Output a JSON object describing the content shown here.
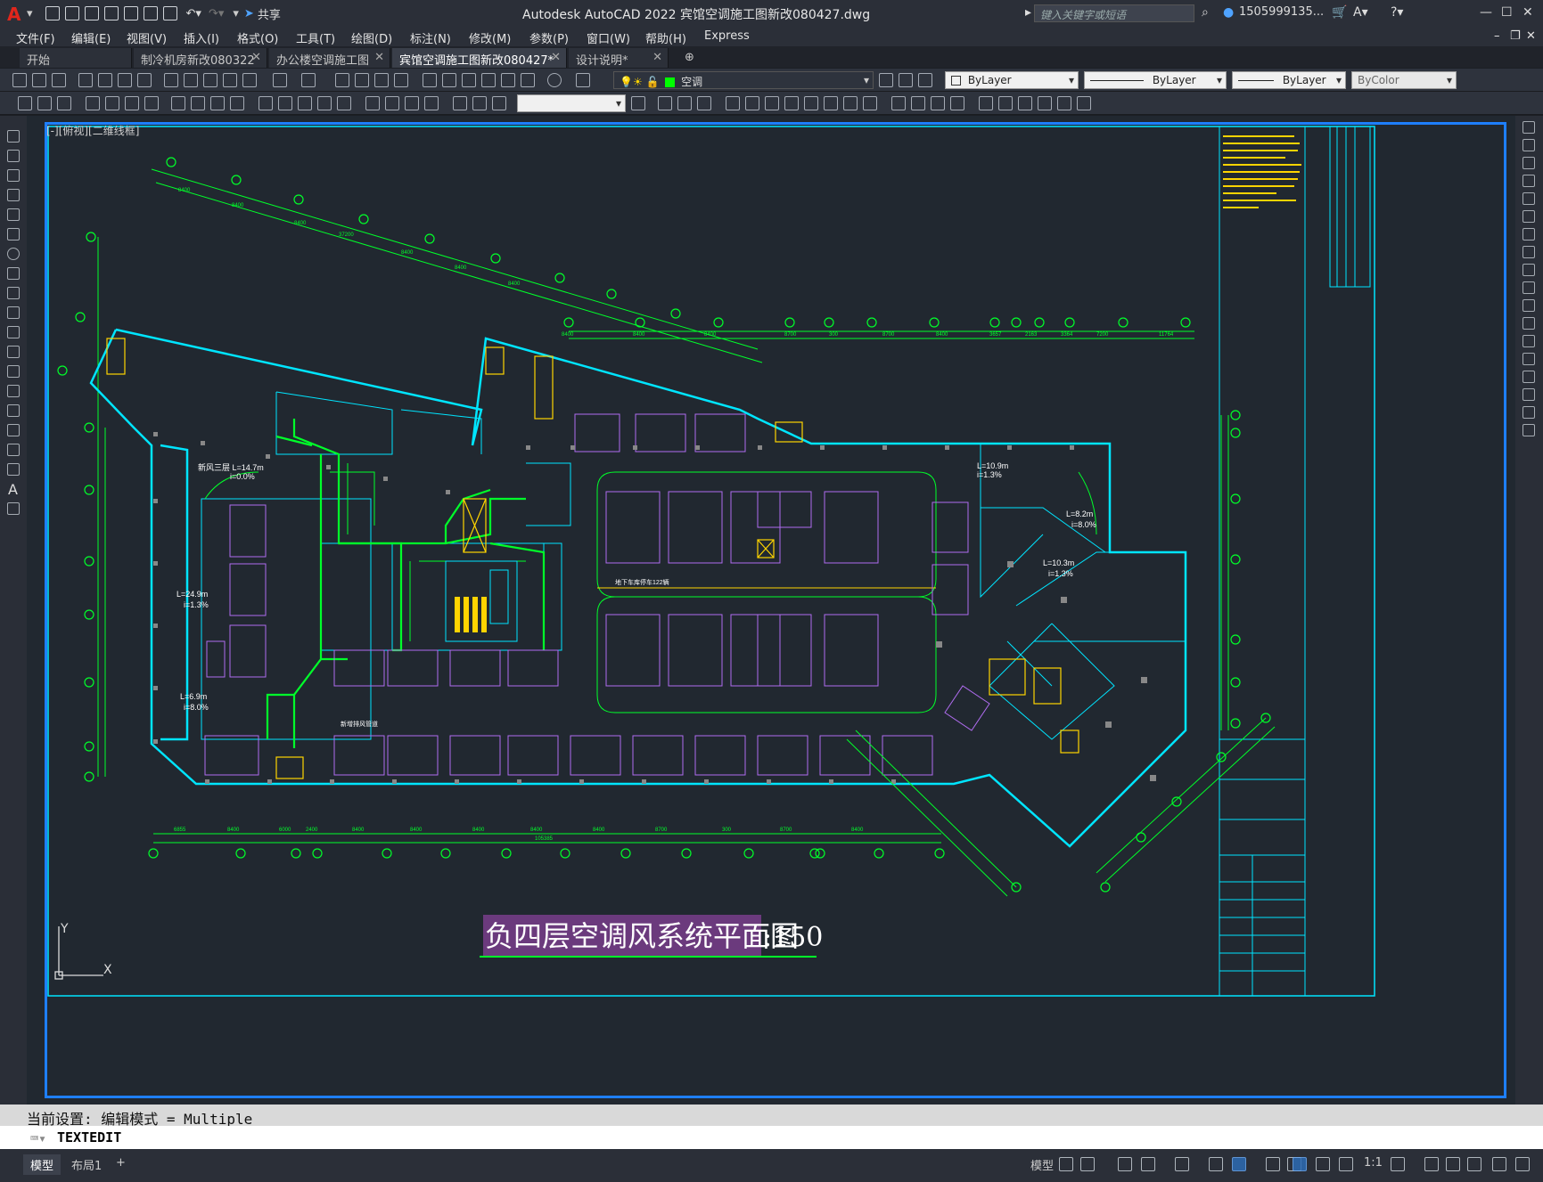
{
  "app": {
    "logo": "A",
    "window_title": "Autodesk AutoCAD 2022    宾馆空调施工图新改080427.dwg",
    "share_label": "共享",
    "search_placeholder": "键入关键字或短语",
    "user": "1505999135...",
    "window_controls": {
      "minimize": "—",
      "maximize": "☐",
      "close": "✕"
    }
  },
  "menu": [
    "文件(F)",
    "编辑(E)",
    "视图(V)",
    "插入(I)",
    "格式(O)",
    "工具(T)",
    "绘图(D)",
    "标注(N)",
    "修改(M)",
    "参数(P)",
    "窗口(W)",
    "帮助(H)",
    "Express"
  ],
  "tabs": [
    {
      "label": "开始",
      "closable": false,
      "active": false
    },
    {
      "label": "制冷机房新改080322",
      "closable": true,
      "active": false
    },
    {
      "label": "办公楼空调施工图",
      "closable": true,
      "active": false
    },
    {
      "label": "宾馆空调施工图新改080427*",
      "closable": true,
      "active": true
    },
    {
      "label": "设计说明*",
      "closable": true,
      "active": false
    }
  ],
  "toolbar": {
    "layer_name": "空调",
    "color": "ByLayer",
    "linetype": "ByLayer",
    "lineweight": "ByLayer",
    "plotstyle": "ByColor"
  },
  "viewport": {
    "label": "[-][俯视][二维线框]",
    "drawing_title": "负四层空调风系统平面图",
    "scale_suffix": ":150",
    "ucs_x": "X",
    "ucs_y": "Y"
  },
  "drawing_text": {
    "dims_top": [
      "8400",
      "8400",
      "8400",
      "37200",
      "8400",
      "8400",
      "8400",
      "2700",
      "5100",
      "2700",
      "2300",
      "8400",
      "8400",
      "8400",
      "8400",
      "8400",
      "8700",
      "300",
      "8700",
      "8400",
      "8400",
      "3657",
      "2163",
      "3364",
      "3914",
      "7200",
      "11764"
    ],
    "dims_bottom": [
      "6855",
      "8400",
      "6000",
      "2400",
      "8400",
      "8400",
      "8400",
      "8400",
      "8400",
      "8700",
      "300",
      "8700",
      "8400",
      "105385"
    ],
    "notes": [
      "新风三层 L=14.7m",
      "i=0.0%",
      "L=10.9m",
      "i=1.3%",
      "L=24.9m",
      "i=1.3%",
      "L=6.9m",
      "i=8.0%",
      "L=10.3m",
      "i=1.3%",
      "L=8.2m",
      "i=8.0%",
      "地下车库停车122辆",
      "新增排风管道"
    ]
  },
  "command": {
    "history": "当前设置: 编辑模式 = Multiple",
    "current": "TEXTEDIT"
  },
  "status": {
    "layout_tabs": [
      "模型",
      "布局1"
    ],
    "add_tab": "+",
    "model_label": "模型",
    "scale": "1:1"
  },
  "colors": {
    "accent": "#1e7fff",
    "walls": "#00e5ff",
    "ducts": "#00ff2a",
    "parking": "#b06cf0",
    "equipment": "#ffd400",
    "title_highlight": "#6b3a7d"
  }
}
